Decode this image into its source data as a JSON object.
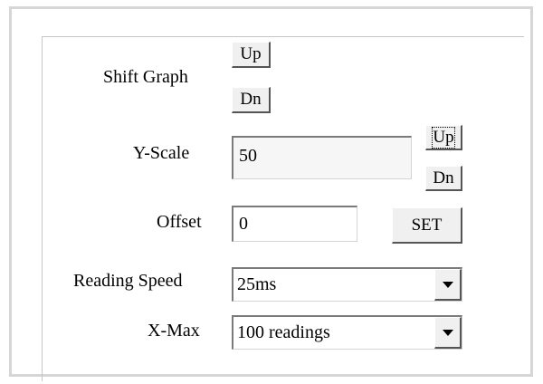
{
  "shift_graph": {
    "label": "Shift Graph",
    "up_label": "Up",
    "down_label": "Dn"
  },
  "y_scale": {
    "label": "Y-Scale",
    "value": "50",
    "up_label": "Up",
    "down_label": "Dn"
  },
  "offset": {
    "label": "Offset",
    "value": "0",
    "set_label": "SET"
  },
  "reading_speed": {
    "label": "Reading Speed",
    "selected": "25ms"
  },
  "x_max": {
    "label": "X-Max",
    "selected": "100 readings"
  },
  "colors": {
    "panel_border": "#d6d6d6",
    "button_face": "#f0f0f0"
  }
}
